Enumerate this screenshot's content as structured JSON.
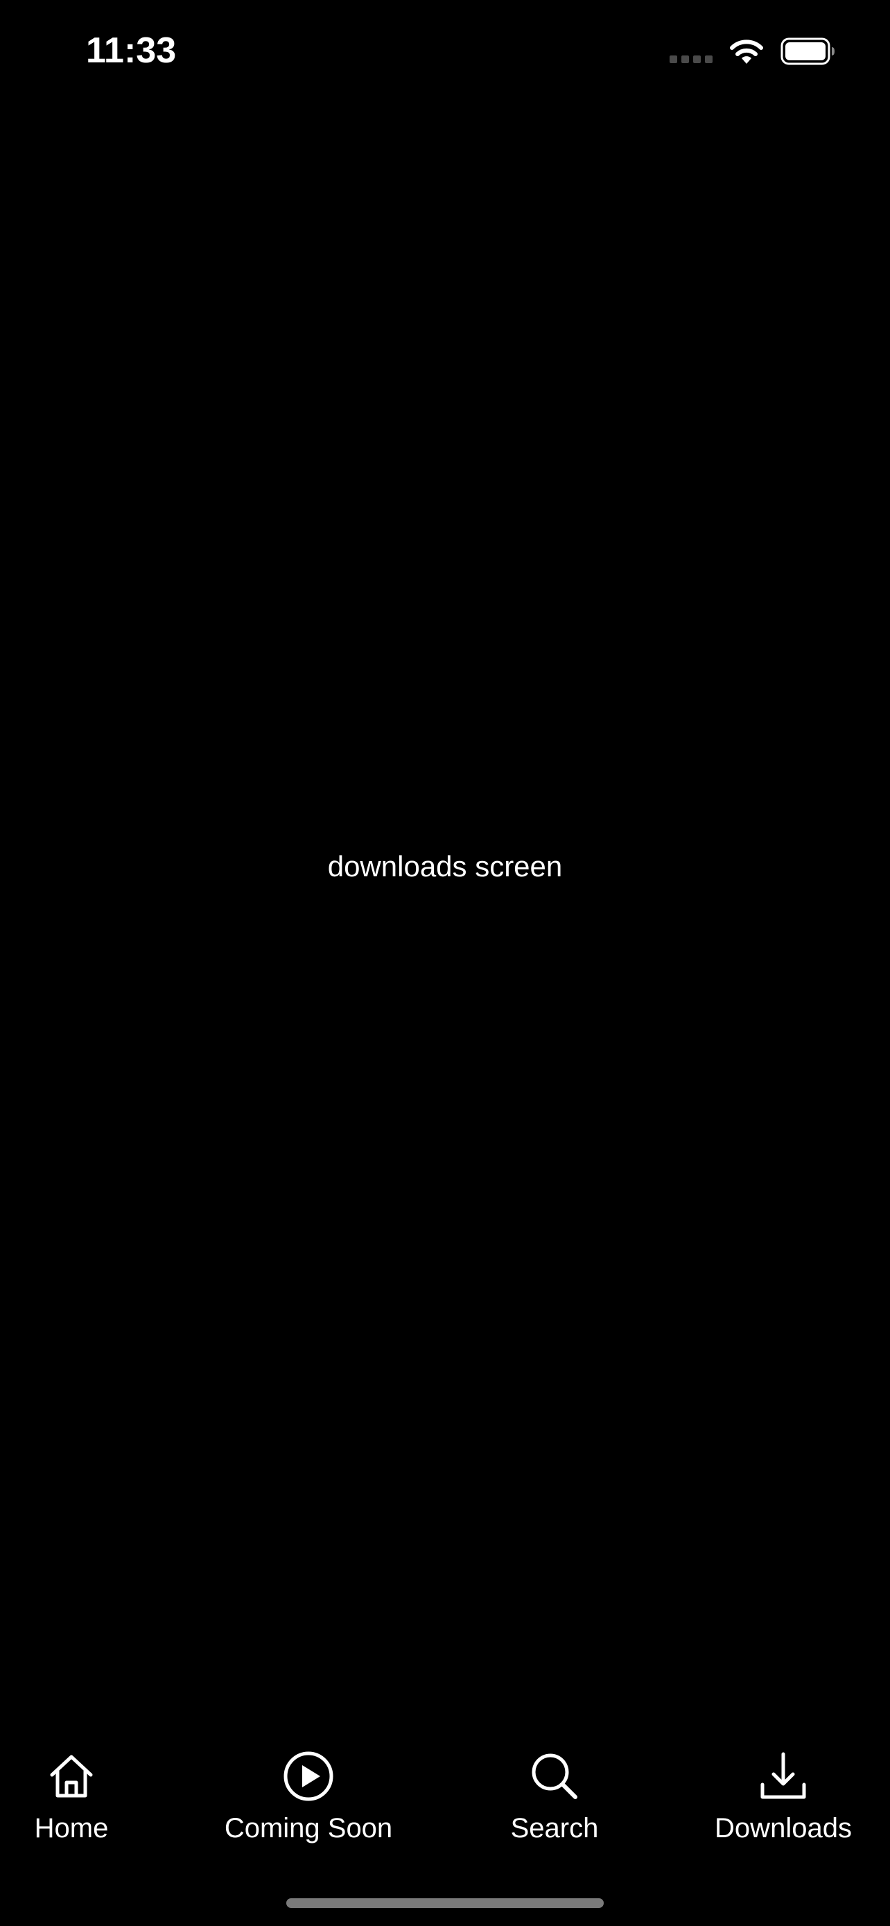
{
  "status_bar": {
    "time": "11:33",
    "icons": [
      "cellular-signal-icon",
      "wifi-icon",
      "battery-icon"
    ]
  },
  "main": {
    "label": "downloads screen"
  },
  "tab_bar": {
    "active_tab": "Downloads",
    "tabs": [
      {
        "label": "Home",
        "icon": "home-icon"
      },
      {
        "label": "Coming Soon",
        "icon": "play-circle-icon"
      },
      {
        "label": "Search",
        "icon": "search-icon"
      },
      {
        "label": "Downloads",
        "icon": "download-icon"
      }
    ]
  },
  "colors": {
    "background": "#000000",
    "foreground": "#ffffff",
    "home_indicator": "#7a7a7a"
  }
}
